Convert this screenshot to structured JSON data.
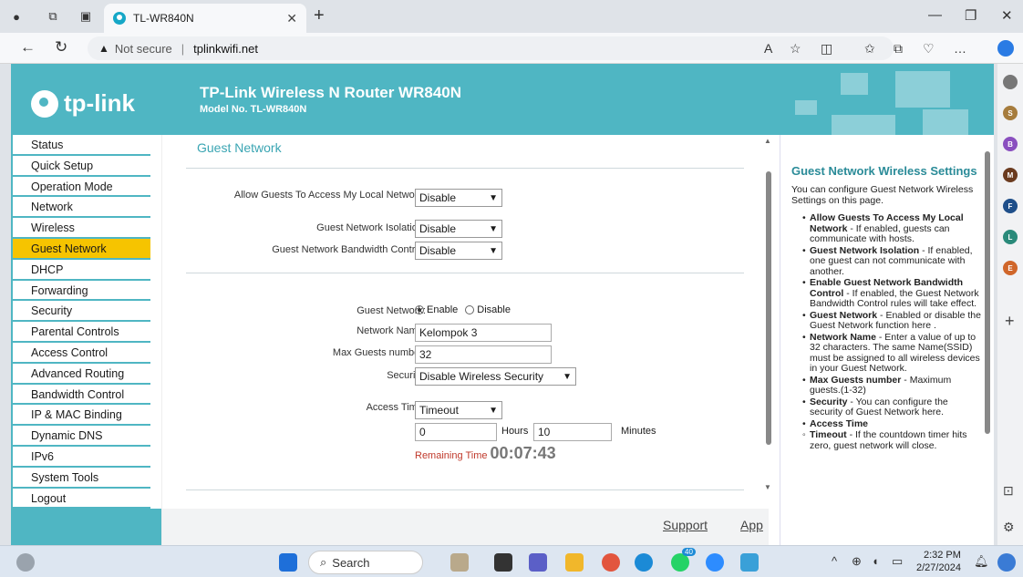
{
  "browser": {
    "tab_title": "TL-WR840N",
    "not_secure": "Not secure",
    "url": "tplinkwifi.net"
  },
  "banner": {
    "logo_text": "tp-link",
    "title": "TP-Link Wireless N Router WR840N",
    "model": "Model No. TL-WR840N"
  },
  "menu": {
    "items": [
      "Status",
      "Quick Setup",
      "Operation Mode",
      "Network",
      "Wireless",
      "Guest Network",
      "DHCP",
      "Forwarding",
      "Security",
      "Parental Controls",
      "Access Control",
      "Advanced Routing",
      "Bandwidth Control",
      "IP & MAC Binding",
      "Dynamic DNS",
      "IPv6",
      "System Tools",
      "Logout"
    ],
    "active": "Guest Network"
  },
  "content": {
    "title": "Guest Network",
    "allow_local_label": "Allow Guests To Access My Local Network:",
    "allow_local_value": "Disable",
    "isolation_label": "Guest Network Isolation:",
    "isolation_value": "Disable",
    "bandwidth_label": "Guest Network Bandwidth Control:",
    "bandwidth_value": "Disable",
    "guest_network_label": "Guest Network:",
    "enable_label": "Enable",
    "disable_label": "Disable",
    "network_name_label": "Network Name:",
    "network_name_value": "Kelompok 3",
    "max_guests_label": "Max Guests number:",
    "max_guests_value": "32",
    "security_label": "Security:",
    "security_value": "Disable Wireless Security",
    "access_time_label": "Access Time:",
    "access_time_value": "Timeout",
    "hours_value": "0",
    "hours_label": "Hours",
    "minutes_value": "10",
    "minutes_label": "Minutes",
    "remaining_label": "Remaining Time",
    "remaining_value": "00:07:43",
    "support": "Support",
    "app": "App"
  },
  "help": {
    "title": "Guest Network Wireless Settings",
    "intro": "You can configure Guest Network Wireless Settings on this page.",
    "items": [
      {
        "term": "Allow Guests To Access My Local Network",
        "desc": " - If enabled, guests can communicate with hosts."
      },
      {
        "term": "Guest Network Isolation",
        "desc": " - If enabled, one guest can not communicate with another."
      },
      {
        "term": "Enable Guest Network Bandwidth Control",
        "desc": " - If enabled, the Guest Network Bandwidth Control rules will take effect."
      },
      {
        "term": "Guest Network",
        "desc": " - Enabled or disable the Guest Network function here ."
      },
      {
        "term": "Network Name",
        "desc": " - Enter a value of up to 32 characters. The same Name(SSID) must be assigned to all wireless devices in your Guest Network."
      },
      {
        "term": "Max Guests number",
        "desc": " - Maximum guests.(1-32)"
      },
      {
        "term": "Security",
        "desc": " - You can configure the security of Guest Network here."
      },
      {
        "term": "Access Time",
        "desc": ""
      }
    ],
    "sub_term": "Timeout",
    "sub_desc": " - If the countdown timer hits zero, guest network will close."
  },
  "taskbar": {
    "search": "Search",
    "time": "2:32 PM",
    "date": "2/27/2024",
    "badge_chat": "40"
  },
  "colors": {
    "brand": "#4fb6c3",
    "active_menu": "#f6c400"
  }
}
